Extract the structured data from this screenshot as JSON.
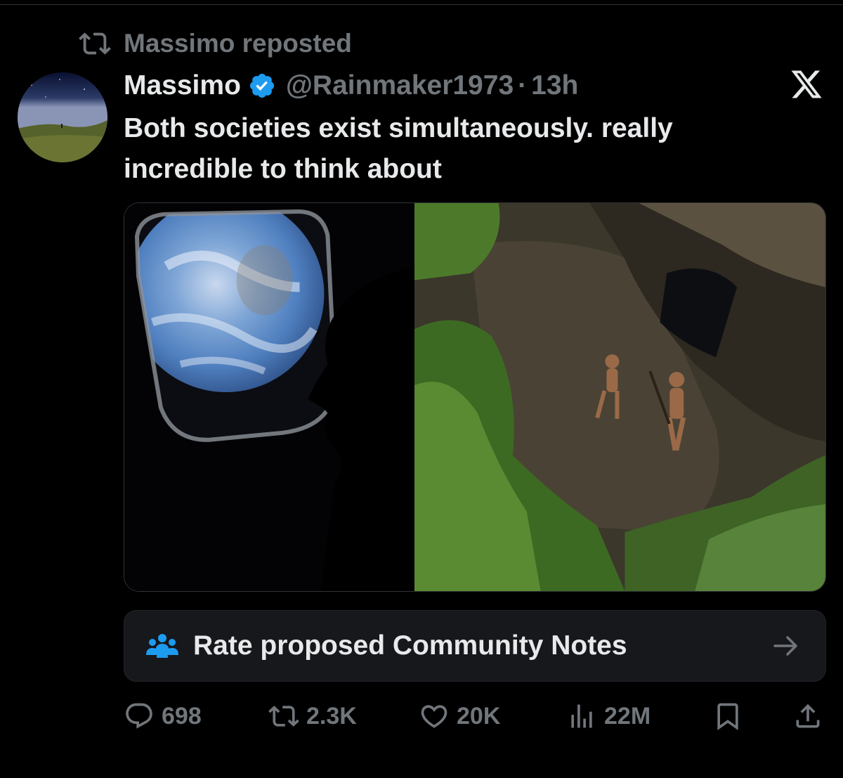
{
  "repost": {
    "text": "Massimo reposted"
  },
  "author": {
    "display_name": "Massimo",
    "handle": "@Rainmaker1973",
    "separator": "·",
    "timestamp": "13h",
    "verified": true
  },
  "tweet": {
    "text_line1": "Both societies exist simultaneously. really",
    "text_line2": "incredible to think about"
  },
  "media": {
    "left_image": "earth-through-spacecraft-window",
    "right_image": "aerial-view-of-tribe-members-by-hut"
  },
  "community_notes": {
    "label": "Rate proposed Community Notes",
    "icon": "people-icon"
  },
  "actions": {
    "replies": "698",
    "reposts": "2.3K",
    "likes": "20K",
    "views": "22M"
  },
  "colors": {
    "background": "#000000",
    "text_primary": "#e7e9ea",
    "text_secondary": "#71767b",
    "accent_blue": "#1d9bf0",
    "notes_bg": "#16181c"
  }
}
